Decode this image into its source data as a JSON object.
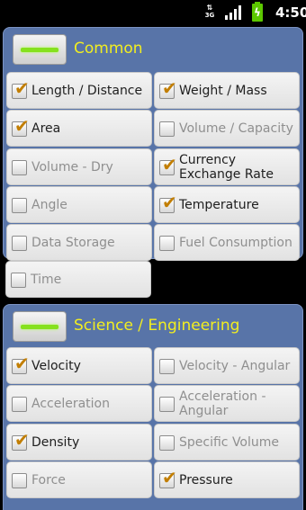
{
  "status": {
    "network": "3G",
    "clock": "4:50"
  },
  "groups": [
    {
      "title": "Common",
      "items": [
        {
          "label": "Length / Distance",
          "checked": true
        },
        {
          "label": "Weight / Mass",
          "checked": true
        },
        {
          "label": "Area",
          "checked": true
        },
        {
          "label": "Volume / Capacity",
          "checked": false
        },
        {
          "label": "Volume - Dry",
          "checked": false
        },
        {
          "label": "Currency Exchange Rate",
          "checked": true
        },
        {
          "label": "Angle",
          "checked": false
        },
        {
          "label": "Temperature",
          "checked": true
        },
        {
          "label": "Data Storage",
          "checked": false
        },
        {
          "label": "Fuel Consumption",
          "checked": false
        },
        {
          "label": "Time",
          "checked": false
        }
      ]
    },
    {
      "title": "Science / Engineering",
      "items": [
        {
          "label": "Velocity",
          "checked": true
        },
        {
          "label": "Velocity - Angular",
          "checked": false
        },
        {
          "label": "Acceleration",
          "checked": false
        },
        {
          "label": "Acceleration - Angular",
          "checked": false
        },
        {
          "label": "Density",
          "checked": true
        },
        {
          "label": "Specific Volume",
          "checked": false
        },
        {
          "label": "Force",
          "checked": false
        },
        {
          "label": "Pressure",
          "checked": true
        }
      ]
    }
  ]
}
